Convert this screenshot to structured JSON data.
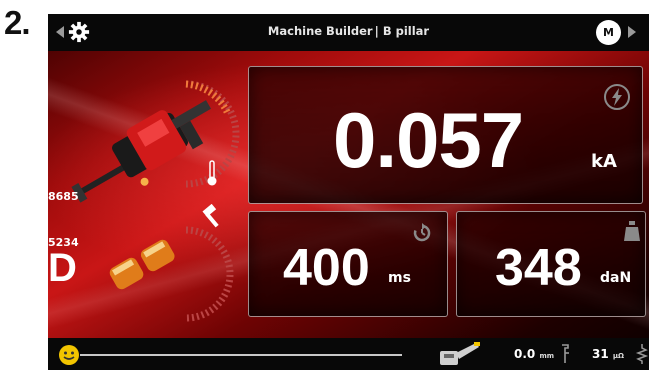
{
  "step_label": "2.",
  "header": {
    "title_left": "Machine Builder",
    "title_separator": "|",
    "title_right": "B pillar",
    "user_initial": "M"
  },
  "left_panel": {
    "counter_top": "8685",
    "counter_bottom": "5234",
    "letter": "D"
  },
  "current_panel": {
    "value": "0.057",
    "unit": "kA"
  },
  "time_panel": {
    "value": "400",
    "unit": "ms"
  },
  "force_panel": {
    "value": "348",
    "unit": "daN"
  },
  "footer": {
    "wear_value": "0.0",
    "wear_unit": "mm",
    "resistance_value": "31",
    "resistance_unit": "µΩ"
  },
  "colors": {
    "accent_yellow": "#f2c500",
    "bar_background": "#080808",
    "panel_border": "#ffffff"
  },
  "icons": [
    "gear-icon",
    "bolt-icon",
    "reset-icon",
    "weight-icon",
    "thermometer-icon",
    "hammer-icon",
    "smiley-icon",
    "tool-icon",
    "wear-icon",
    "resistor-icon"
  ]
}
